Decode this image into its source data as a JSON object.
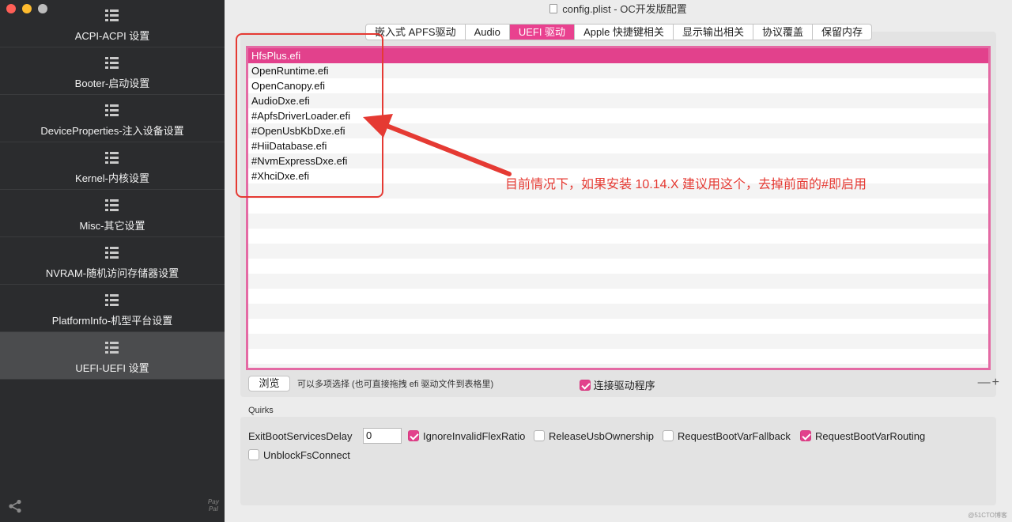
{
  "sidebar": {
    "items": [
      {
        "label": "ACPI-ACPI 设置"
      },
      {
        "label": "Booter-启动设置"
      },
      {
        "label": "DeviceProperties-注入设备设置"
      },
      {
        "label": "Kernel-内核设置"
      },
      {
        "label": "Misc-其它设置"
      },
      {
        "label": "NVRAM-随机访问存储器设置"
      },
      {
        "label": "PlatformInfo-机型平台设置"
      },
      {
        "label": "UEFI-UEFI 设置"
      }
    ],
    "active_index": 7,
    "footer_paypal": "Pay Pal"
  },
  "window": {
    "title": "config.plist - OC开发版配置"
  },
  "tabs": [
    {
      "label": "嵌入式 APFS驱动"
    },
    {
      "label": "Audio"
    },
    {
      "label": "UEFI 驱动"
    },
    {
      "label": "Apple 快捷键相关"
    },
    {
      "label": "显示输出相关"
    },
    {
      "label": "协议覆盖"
    },
    {
      "label": "保留内存"
    }
  ],
  "active_tab": 2,
  "drivers": [
    {
      "name": "HfsPlus.efi"
    },
    {
      "name": "OpenRuntime.efi"
    },
    {
      "name": "OpenCanopy.efi"
    },
    {
      "name": "AudioDxe.efi"
    },
    {
      "name": "#ApfsDriverLoader.efi"
    },
    {
      "name": "#OpenUsbKbDxe.efi"
    },
    {
      "name": "#HiiDatabase.efi"
    },
    {
      "name": "#NvmExpressDxe.efi"
    },
    {
      "name": "#XhciDxe.efi"
    }
  ],
  "annotation": "目前情况下，如果安装 10.14.X 建议用这个，去掉前面的#即启用",
  "controls": {
    "browse_label": "浏览",
    "hint": "可以多项选择 (也可直接拖拽 efi 驱动文件到表格里)",
    "connect_label": "连接驱动程序",
    "connect_checked": true,
    "plusminus": "—+"
  },
  "quirks": {
    "title": "Quirks",
    "exit_boot_label": "ExitBootServicesDelay",
    "exit_boot_value": "0",
    "ignore_invalid": {
      "label": "IgnoreInvalidFlexRatio",
      "checked": true
    },
    "release_usb": {
      "label": "ReleaseUsbOwnership",
      "checked": false
    },
    "request_fallback": {
      "label": "RequestBootVarFallback",
      "checked": false
    },
    "request_routing": {
      "label": "RequestBootVarRouting",
      "checked": true
    },
    "unblock_fs": {
      "label": "UnblockFsConnect",
      "checked": false
    }
  },
  "watermark": "@51CTO博客",
  "colors": {
    "accent": "#e2418c",
    "annotation": "#e53a33",
    "sidebar": "#2b2c2e"
  }
}
